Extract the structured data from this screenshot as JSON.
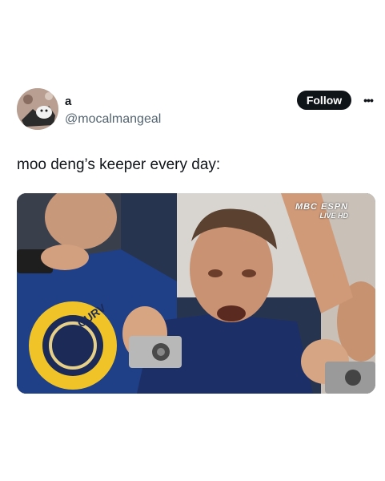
{
  "post": {
    "author_name": "a",
    "author_handle": "@mocalmangeal",
    "follow_label": "Follow",
    "more_label": "•••",
    "text": "moo deng’s keeper every day:"
  },
  "media": {
    "description_icon": "photo-crying-fan-with-camera",
    "watermark_main": "MBC ESPN",
    "watermark_sub": "LIVE HD",
    "jersey_text": "CURV"
  },
  "colors": {
    "follow_bg": "#0f1419",
    "handle": "#536471",
    "text": "#0f1419"
  }
}
